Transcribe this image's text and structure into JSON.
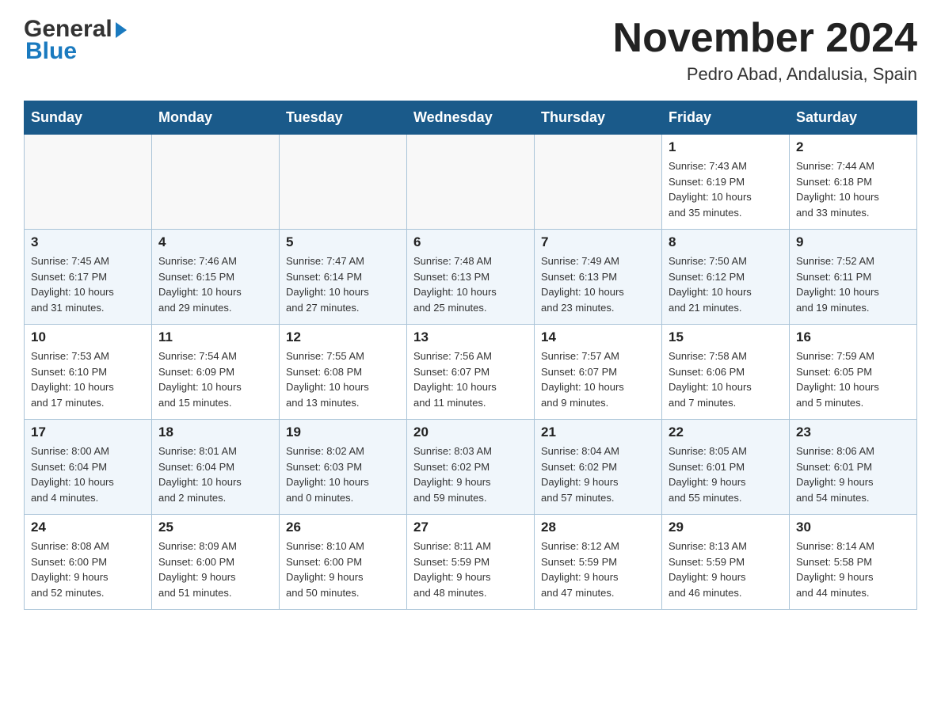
{
  "logo": {
    "general": "General",
    "blue": "Blue",
    "arrow": "▶"
  },
  "title": "November 2024",
  "subtitle": "Pedro Abad, Andalusia, Spain",
  "weekdays": [
    "Sunday",
    "Monday",
    "Tuesday",
    "Wednesday",
    "Thursday",
    "Friday",
    "Saturday"
  ],
  "weeks": [
    [
      {
        "day": "",
        "info": ""
      },
      {
        "day": "",
        "info": ""
      },
      {
        "day": "",
        "info": ""
      },
      {
        "day": "",
        "info": ""
      },
      {
        "day": "",
        "info": ""
      },
      {
        "day": "1",
        "info": "Sunrise: 7:43 AM\nSunset: 6:19 PM\nDaylight: 10 hours\nand 35 minutes."
      },
      {
        "day": "2",
        "info": "Sunrise: 7:44 AM\nSunset: 6:18 PM\nDaylight: 10 hours\nand 33 minutes."
      }
    ],
    [
      {
        "day": "3",
        "info": "Sunrise: 7:45 AM\nSunset: 6:17 PM\nDaylight: 10 hours\nand 31 minutes."
      },
      {
        "day": "4",
        "info": "Sunrise: 7:46 AM\nSunset: 6:15 PM\nDaylight: 10 hours\nand 29 minutes."
      },
      {
        "day": "5",
        "info": "Sunrise: 7:47 AM\nSunset: 6:14 PM\nDaylight: 10 hours\nand 27 minutes."
      },
      {
        "day": "6",
        "info": "Sunrise: 7:48 AM\nSunset: 6:13 PM\nDaylight: 10 hours\nand 25 minutes."
      },
      {
        "day": "7",
        "info": "Sunrise: 7:49 AM\nSunset: 6:13 PM\nDaylight: 10 hours\nand 23 minutes."
      },
      {
        "day": "8",
        "info": "Sunrise: 7:50 AM\nSunset: 6:12 PM\nDaylight: 10 hours\nand 21 minutes."
      },
      {
        "day": "9",
        "info": "Sunrise: 7:52 AM\nSunset: 6:11 PM\nDaylight: 10 hours\nand 19 minutes."
      }
    ],
    [
      {
        "day": "10",
        "info": "Sunrise: 7:53 AM\nSunset: 6:10 PM\nDaylight: 10 hours\nand 17 minutes."
      },
      {
        "day": "11",
        "info": "Sunrise: 7:54 AM\nSunset: 6:09 PM\nDaylight: 10 hours\nand 15 minutes."
      },
      {
        "day": "12",
        "info": "Sunrise: 7:55 AM\nSunset: 6:08 PM\nDaylight: 10 hours\nand 13 minutes."
      },
      {
        "day": "13",
        "info": "Sunrise: 7:56 AM\nSunset: 6:07 PM\nDaylight: 10 hours\nand 11 minutes."
      },
      {
        "day": "14",
        "info": "Sunrise: 7:57 AM\nSunset: 6:07 PM\nDaylight: 10 hours\nand 9 minutes."
      },
      {
        "day": "15",
        "info": "Sunrise: 7:58 AM\nSunset: 6:06 PM\nDaylight: 10 hours\nand 7 minutes."
      },
      {
        "day": "16",
        "info": "Sunrise: 7:59 AM\nSunset: 6:05 PM\nDaylight: 10 hours\nand 5 minutes."
      }
    ],
    [
      {
        "day": "17",
        "info": "Sunrise: 8:00 AM\nSunset: 6:04 PM\nDaylight: 10 hours\nand 4 minutes."
      },
      {
        "day": "18",
        "info": "Sunrise: 8:01 AM\nSunset: 6:04 PM\nDaylight: 10 hours\nand 2 minutes."
      },
      {
        "day": "19",
        "info": "Sunrise: 8:02 AM\nSunset: 6:03 PM\nDaylight: 10 hours\nand 0 minutes."
      },
      {
        "day": "20",
        "info": "Sunrise: 8:03 AM\nSunset: 6:02 PM\nDaylight: 9 hours\nand 59 minutes."
      },
      {
        "day": "21",
        "info": "Sunrise: 8:04 AM\nSunset: 6:02 PM\nDaylight: 9 hours\nand 57 minutes."
      },
      {
        "day": "22",
        "info": "Sunrise: 8:05 AM\nSunset: 6:01 PM\nDaylight: 9 hours\nand 55 minutes."
      },
      {
        "day": "23",
        "info": "Sunrise: 8:06 AM\nSunset: 6:01 PM\nDaylight: 9 hours\nand 54 minutes."
      }
    ],
    [
      {
        "day": "24",
        "info": "Sunrise: 8:08 AM\nSunset: 6:00 PM\nDaylight: 9 hours\nand 52 minutes."
      },
      {
        "day": "25",
        "info": "Sunrise: 8:09 AM\nSunset: 6:00 PM\nDaylight: 9 hours\nand 51 minutes."
      },
      {
        "day": "26",
        "info": "Sunrise: 8:10 AM\nSunset: 6:00 PM\nDaylight: 9 hours\nand 50 minutes."
      },
      {
        "day": "27",
        "info": "Sunrise: 8:11 AM\nSunset: 5:59 PM\nDaylight: 9 hours\nand 48 minutes."
      },
      {
        "day": "28",
        "info": "Sunrise: 8:12 AM\nSunset: 5:59 PM\nDaylight: 9 hours\nand 47 minutes."
      },
      {
        "day": "29",
        "info": "Sunrise: 8:13 AM\nSunset: 5:59 PM\nDaylight: 9 hours\nand 46 minutes."
      },
      {
        "day": "30",
        "info": "Sunrise: 8:14 AM\nSunset: 5:58 PM\nDaylight: 9 hours\nand 44 minutes."
      }
    ]
  ]
}
